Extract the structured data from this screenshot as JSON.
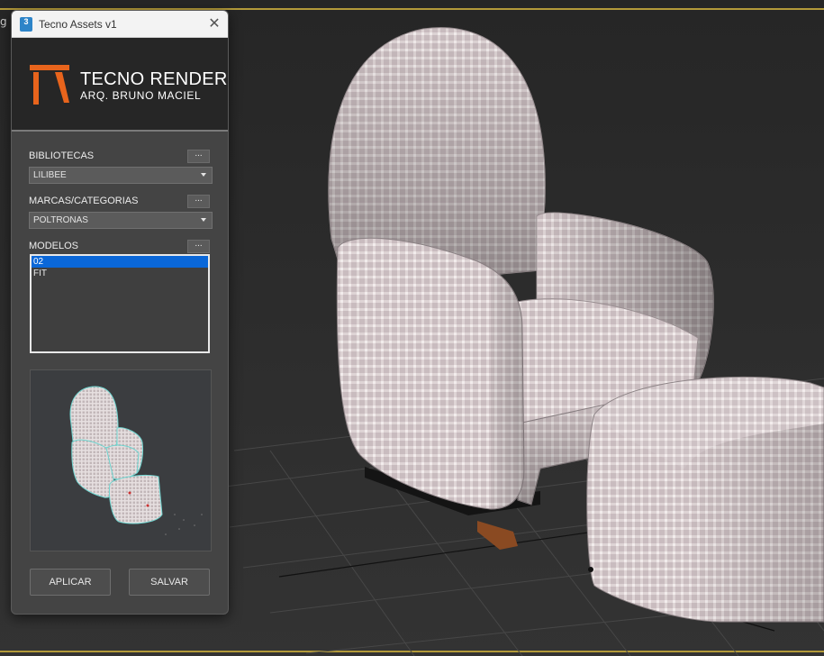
{
  "viewport": {
    "label": "g ]",
    "colors": {
      "border": "#b39a3a",
      "fabric": "#d2c6c8"
    }
  },
  "dialog": {
    "title": "Tecno Assets v1",
    "app_icon": "3",
    "close_glyph": "✕",
    "brand": {
      "title": "TECNO RENDER",
      "subtitle": "ARQ. BRUNO MACIEL",
      "accent": "#e8641c"
    },
    "bibliotecas": {
      "label": "BIBLIOTECAS",
      "button": "...",
      "selected": "LILIBEE"
    },
    "marcas": {
      "label": "MARCAS/CATEGORIAS",
      "button": "...",
      "selected": "POLTRONAS"
    },
    "modelos": {
      "label": "MODELOS",
      "button": "...",
      "items": [
        {
          "label": "02",
          "selected": true
        },
        {
          "label": "FIT",
          "selected": false
        }
      ]
    },
    "buttons": {
      "apply": "APLICAR",
      "save": "SALVAR"
    }
  }
}
